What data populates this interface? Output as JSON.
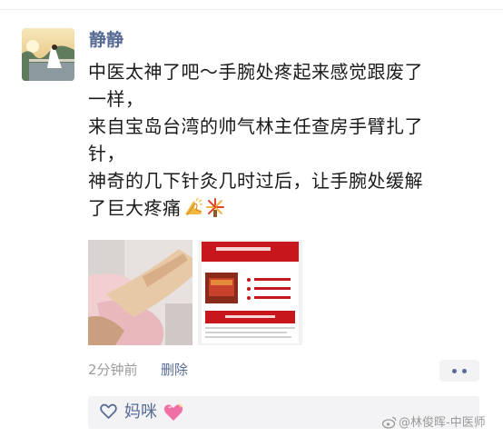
{
  "post": {
    "author": "静静",
    "text_lines": [
      "中医太神了吧～手腕处疼起来感觉跟废了",
      "一样，",
      "来自宝岛台湾的帅气林主任查房手臂扎了",
      "针，",
      "神奇的几下针灸几时过后，让手腕处缓解",
      "了巨大疼痛"
    ],
    "emojis": [
      "folded-hands-icon",
      "fireworks-icon"
    ],
    "time": "2分钟前",
    "delete_label": "删除",
    "photos": [
      "photo-massage-arm",
      "photo-hospital-document"
    ]
  },
  "likes": {
    "names": [
      "妈咪"
    ],
    "emoji": "sparkling-heart-icon"
  },
  "watermark": {
    "text": "@林俊晖-中医师"
  },
  "colors": {
    "link_blue": "#576b95",
    "text": "#1a1a1a",
    "meta_gray": "#9b9b9b",
    "panel_bg": "#f3f3f5",
    "document_red": "#c8161d"
  }
}
